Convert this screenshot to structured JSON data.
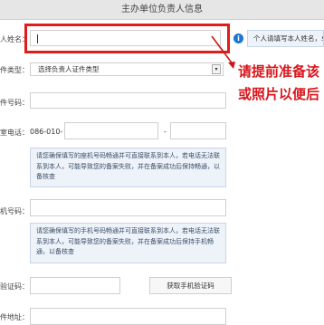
{
  "header": {
    "title": "主办单位负责人信息"
  },
  "rows": {
    "name": {
      "label": "人姓名：",
      "placeholder": ""
    },
    "id_type": {
      "label": "件类型：",
      "selected": "选择负责人证件类型",
      "dropdown_icon": "▾"
    },
    "id_number": {
      "label": "件号码："
    },
    "office_phone": {
      "label": "室电话：",
      "prefix": "086-010-",
      "separator": "-"
    },
    "mobile": {
      "label": "机号码："
    },
    "captcha": {
      "label": "验证码：",
      "button": "获取手机验证码"
    },
    "address": {
      "label": "件地址："
    }
  },
  "name_tip": {
    "icon": "i",
    "text": "个人请填写本人姓名，单位"
  },
  "red_note": {
    "line1": "请提前准备该",
    "line2": "或照片以便后"
  },
  "hint_office": "请您确保填写的座机号码畅通并可直接联系到本人，若电话无法联系到本人，可能导致您的备案失败，并在备案成功后保持畅通，以备核查",
  "hint_mobile": "请您确保填写的手机号码畅通并可直接联系到本人，若电话无法联系到本人，可能导致您的备案失败，并在备案成功后保持手机畅通，以备核查",
  "colors": {
    "accent_red": "#e31b1b",
    "info_blue": "#1976d2"
  }
}
